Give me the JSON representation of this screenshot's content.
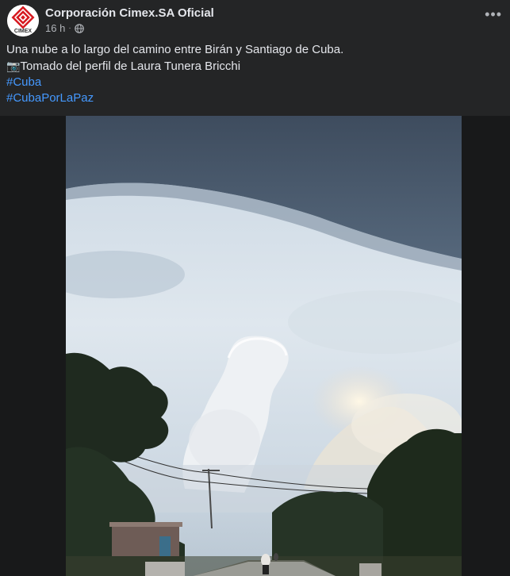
{
  "post": {
    "page_name": "Corporación Cimex.SA Oficial",
    "time": "16 h",
    "audience_icon": "globe-icon",
    "avatar_text": "CIMEX",
    "more_icon": "more-dots-icon",
    "caption_line1": "Una nube a lo largo del camino entre Birán y Santiago de Cuba.",
    "caption_line2_icon": "camera-icon",
    "caption_line2": "Tomado del perfil de Laura Tunera Bricchi",
    "hashtags": [
      "#Cuba",
      "#CubaPorLaPaz"
    ]
  },
  "colors": {
    "background": "#242526",
    "text": "#e4e6eb",
    "secondary_text": "#b0b3b8",
    "link": "#4599ff",
    "brand_red": "#d71920"
  }
}
